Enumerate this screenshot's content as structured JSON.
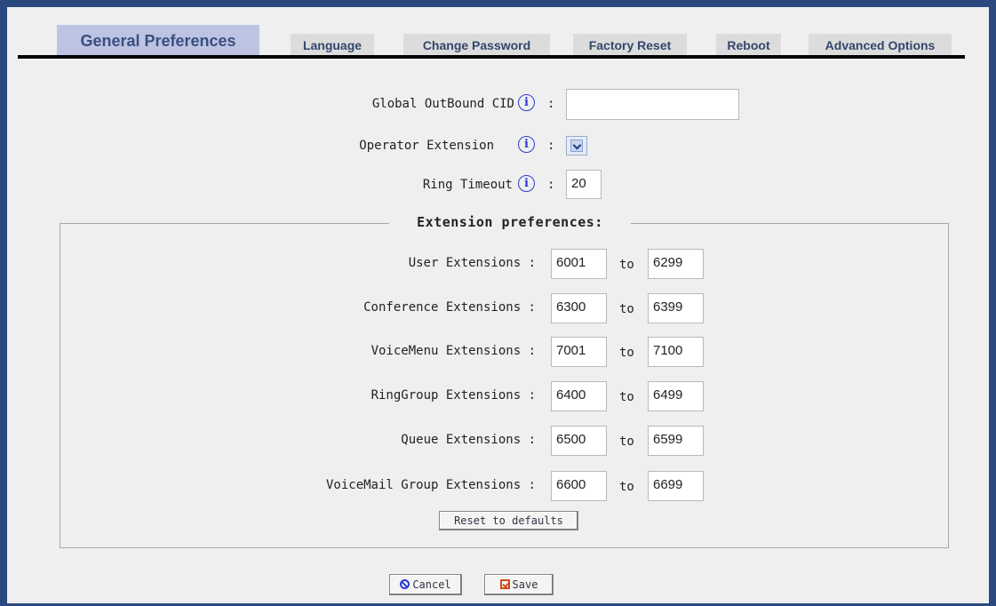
{
  "tabs": [
    {
      "label": "General Preferences",
      "active": true
    },
    {
      "label": "Language"
    },
    {
      "label": "Change Password"
    },
    {
      "label": "Factory Reset"
    },
    {
      "label": "Reboot"
    },
    {
      "label": "Advanced Options"
    }
  ],
  "general": {
    "outbound_cid_label": "Global OutBound CID",
    "outbound_cid_value": "",
    "operator_ext_label": "Operator Extension",
    "ring_timeout_label": "Ring Timeout",
    "ring_timeout_value": "20",
    "info_glyph": "i",
    "colon": ":"
  },
  "extensions": {
    "legend": "Extension preferences:",
    "to_label": "to",
    "rows": [
      {
        "label": "User Extensions :",
        "from": "6001",
        "to": "6299"
      },
      {
        "label": "Conference Extensions :",
        "from": "6300",
        "to": "6399"
      },
      {
        "label": "VoiceMenu Extensions :",
        "from": "7001",
        "to": "7100"
      },
      {
        "label": "RingGroup Extensions :",
        "from": "6400",
        "to": "6499"
      },
      {
        "label": "Queue Extensions :",
        "from": "6500",
        "to": "6599"
      },
      {
        "label": "VoiceMail Group Extensions :",
        "from": "6600",
        "to": "6699"
      }
    ],
    "reset_label": "Reset to defaults"
  },
  "actions": {
    "cancel_label": "Cancel",
    "save_label": "Save"
  },
  "colors": {
    "tab_active_bg": "#bdc4e3",
    "tab_bg": "#dcdcdc",
    "info_blue": "#2a3ccf",
    "save_orange": "#d24a15"
  }
}
